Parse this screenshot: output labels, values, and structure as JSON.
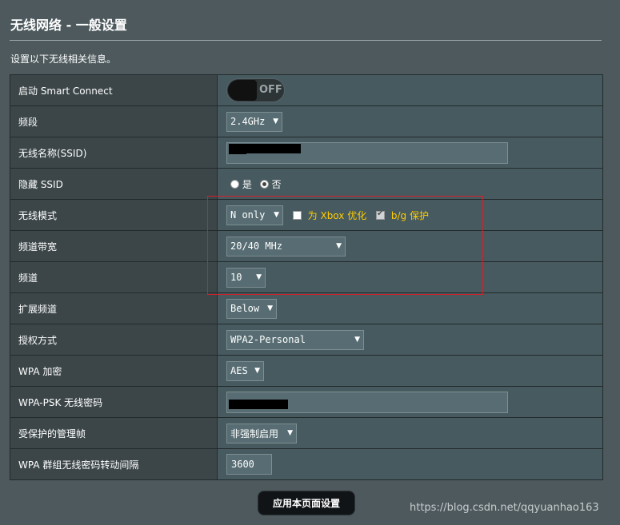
{
  "page": {
    "title": "无线网络 - 一般设置",
    "description": "设置以下无线相关信息。"
  },
  "rows": {
    "smart_connect": {
      "label": "启动 Smart Connect",
      "toggle_text": "OFF"
    },
    "band": {
      "label": "频段",
      "value": "2.4GHz"
    },
    "ssid": {
      "label": "无线名称(SSID)"
    },
    "hide_ssid": {
      "label": "隐藏 SSID",
      "yes": "是",
      "no": "否",
      "selected": "no"
    },
    "wireless_mode": {
      "label": "无线模式",
      "value": "N only",
      "xbox_label": "为 Xbox 优化",
      "xbox_checked": false,
      "bg_label": "b/g 保护",
      "bg_checked": true
    },
    "channel_bandwidth": {
      "label": "频道带宽",
      "value": "20/40 MHz"
    },
    "channel": {
      "label": "频道",
      "value": "10"
    },
    "extension_channel": {
      "label": "扩展频道",
      "value": "Below"
    },
    "auth_method": {
      "label": "授权方式",
      "value": "WPA2-Personal"
    },
    "wpa_encryption": {
      "label": "WPA 加密",
      "value": "AES"
    },
    "wpa_psk": {
      "label": "WPA-PSK 无线密码"
    },
    "pmf": {
      "label": "受保护的管理帧",
      "value": "非强制启用"
    },
    "group_key": {
      "label": "WPA 群组无线密码转动间隔",
      "value": "3600"
    }
  },
  "actions": {
    "apply_label": "应用本页面设置"
  },
  "watermark": "https://blog.csdn.net/qqyuanhao163",
  "colors": {
    "background": "#4d595d",
    "highlight": "#d0202a",
    "option_label": "#ffcc00"
  },
  "icons": {
    "dropdown": "chevron-down-icon"
  }
}
